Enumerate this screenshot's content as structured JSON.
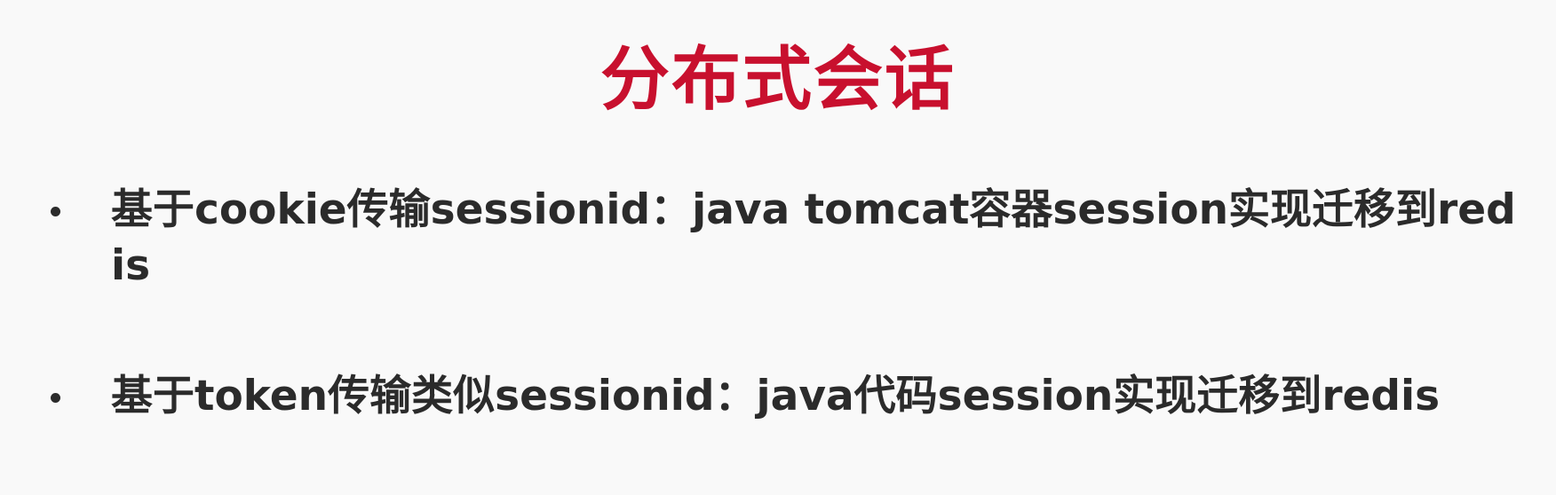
{
  "slide": {
    "title": "分布式会话",
    "bullets": [
      {
        "text": "基于cookie传输sessionid：java tomcat容器session实现迁移到redis"
      },
      {
        "text": "基于token传输类似sessionid：java代码session实现迁移到redis"
      }
    ]
  },
  "colors": {
    "title": "#c8102e",
    "body_text": "#2b2b2b",
    "background": "#f9f9f9"
  }
}
